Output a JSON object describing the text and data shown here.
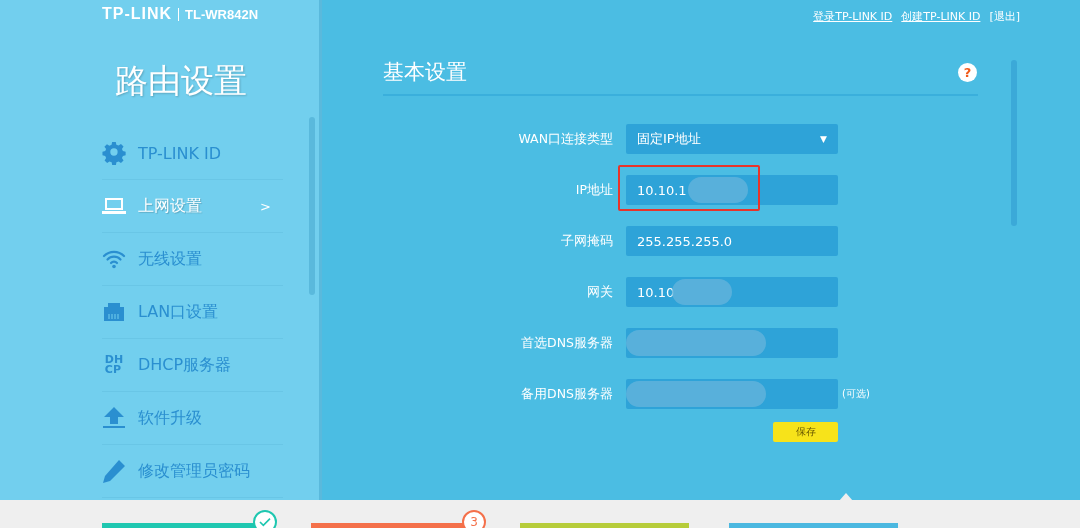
{
  "brand": {
    "logo": "TP-LINK",
    "model": "TL-WR842N"
  },
  "header_links": [
    {
      "label": "登录TP-LINK ID",
      "kind": "link"
    },
    {
      "label": "创建TP-LINK ID",
      "kind": "link"
    },
    {
      "label": "[退出]",
      "kind": "plain"
    }
  ],
  "sidebar": {
    "title": "路由设置",
    "items": [
      {
        "label": "TP-LINK ID",
        "selected": false
      },
      {
        "label": "上网设置",
        "selected": true,
        "arrow": ">"
      },
      {
        "label": "无线设置",
        "selected": false
      },
      {
        "label": "LAN口设置",
        "selected": false
      },
      {
        "label": "DHCP服务器",
        "icon_text": [
          "DH",
          "CP"
        ],
        "selected": false
      },
      {
        "label": "软件升级",
        "selected": false
      },
      {
        "label": "修改管理员密码",
        "selected": false
      }
    ]
  },
  "panel": {
    "title": "基本设置",
    "help": "?",
    "fields": [
      {
        "label": "WAN口连接类型",
        "kind": "select",
        "value": "固定IP地址",
        "caret": "▼"
      },
      {
        "label": "IP地址",
        "kind": "input",
        "value": "10.10.1",
        "redacted": true,
        "highlighted": true
      },
      {
        "label": "子网掩码",
        "kind": "input",
        "value": "255.255.255.0"
      },
      {
        "label": "网关",
        "kind": "input",
        "value": "10.10",
        "redacted": true
      },
      {
        "label": "首选DNS服务器",
        "kind": "input",
        "redacted": true
      },
      {
        "label": "备用DNS服务器",
        "kind": "input",
        "redacted": true,
        "note": "(可选)"
      }
    ],
    "save_button": "保存"
  },
  "steps": [
    {
      "color": "#1fc7b0",
      "done": true
    },
    {
      "color": "#f4704a",
      "badge": "3"
    },
    {
      "color": "#b6cc3a"
    },
    {
      "color": "#4bb8e0"
    }
  ]
}
